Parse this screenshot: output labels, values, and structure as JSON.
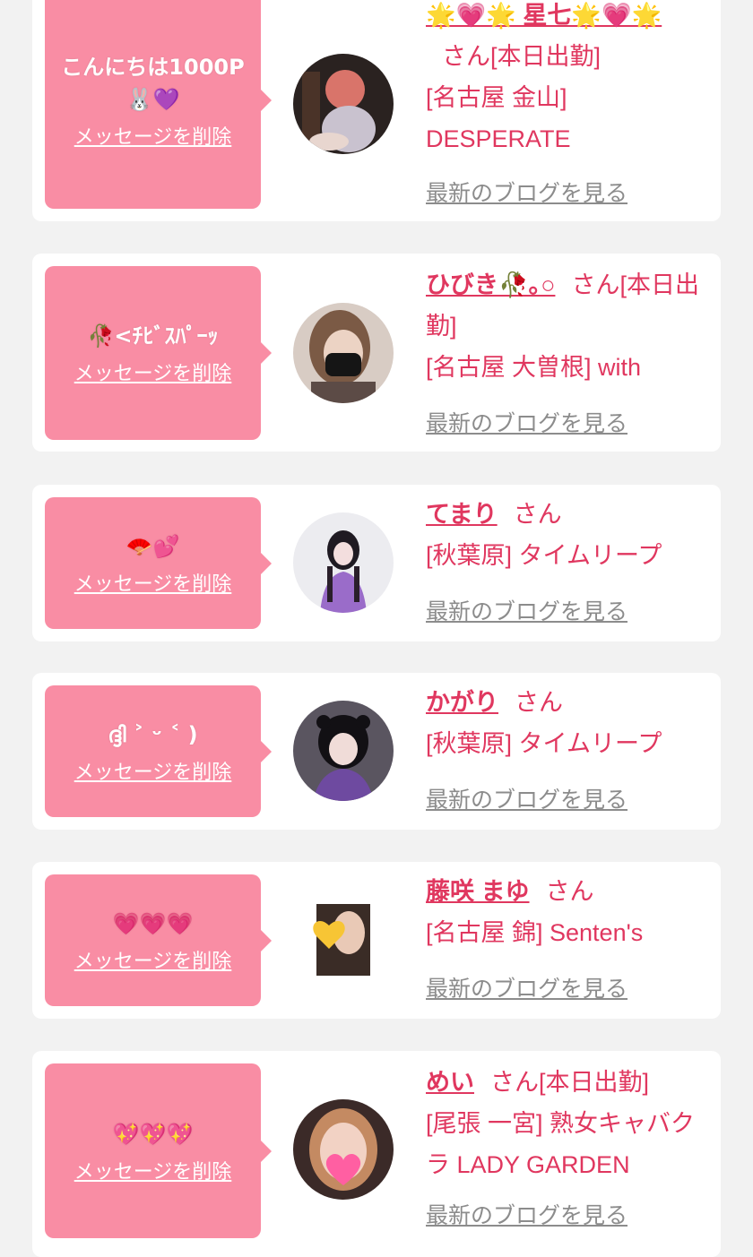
{
  "messages": [
    {
      "message": "こんにちは1000P 🐰💜",
      "delete_label": "メッセージを削除",
      "name": "🌟💗🌟 星七🌟💗🌟",
      "honorific": "さん",
      "status": "[本日出勤]",
      "shop": "[名古屋 金山] DESPERATE",
      "blog_label": "最新のブログを見る"
    },
    {
      "message": "🥀<ﾁﾋﾞｽﾊﾟｰｯ",
      "delete_label": "メッセージを削除",
      "name": "ひびき🥀｡○",
      "honorific": "さん",
      "status": "[本日出勤]",
      "shop": "[名古屋 大曽根] with",
      "blog_label": "最新のブログを見る"
    },
    {
      "message": "🪭💕",
      "delete_label": "メッセージを削除",
      "name": "てまり",
      "honorific": "さん",
      "status": "",
      "shop": "[秋葉原] タイムリープ",
      "blog_label": "最新のブログを見る"
    },
    {
      "message": "ദ്ദി ˃ ᵕ ˂ )",
      "delete_label": "メッセージを削除",
      "name": "かがり",
      "honorific": "さん",
      "status": "",
      "shop": "[秋葉原] タイムリープ",
      "blog_label": "最新のブログを見る"
    },
    {
      "message": "💗💗💗",
      "delete_label": "メッセージを削除",
      "name": "藤咲 まゆ",
      "honorific": "さん",
      "status": "",
      "shop": "[名古屋 錦] Senten's",
      "blog_label": "最新のブログを見る"
    },
    {
      "message": "💖💖💖",
      "delete_label": "メッセージを削除",
      "name": "めい",
      "honorific": "さん",
      "status": "[本日出勤]",
      "shop": "[尾張 一宮] 熟女キャバクラ LADY GARDEN",
      "blog_label": "最新のブログを見る"
    }
  ],
  "colors": {
    "bubble": "#f98da4",
    "accent_text": "#e0375f",
    "link_gray": "#8c8c8c",
    "card": "#ffffff",
    "page_bg": "#f2f2f2"
  },
  "icons": [
    "avatar-photo",
    "heart-emoji",
    "star-emoji",
    "rose-emoji",
    "fan-emoji",
    "rabbit-emoji"
  ]
}
